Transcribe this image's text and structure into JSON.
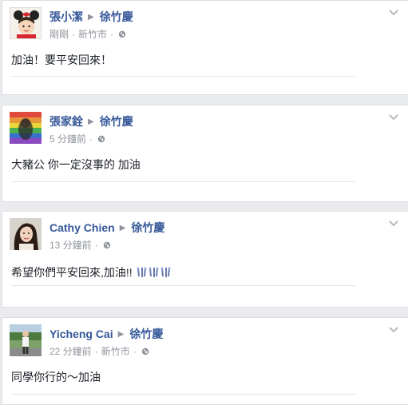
{
  "posts": [
    {
      "author": "張小潔",
      "target": "徐竹慶",
      "time": "剛剛",
      "location": "新竹市",
      "text": "加油！要平安回來！",
      "avatar_icon": "minnie-ears-avatar"
    },
    {
      "author": "張家銓",
      "target": "徐竹慶",
      "time": "5 分鐘前",
      "location": "",
      "text": "大豬公 你一定沒事的 加油",
      "avatar_icon": "rainbow-avatar"
    },
    {
      "author": "Cathy Chien",
      "target": "徐竹慶",
      "time": "13 分鐘前",
      "location": "",
      "text": "希望你們平安回來,加油!!",
      "avatar_icon": "woman-avatar"
    },
    {
      "author": "Yicheng Cai",
      "target": "徐竹慶",
      "time": "22 分鐘前",
      "location": "新竹市",
      "text": "同學你行的～加油",
      "avatar_icon": "outdoor-avatar"
    }
  ],
  "colors": {
    "link": "#365899",
    "meta": "#90949c",
    "text": "#1d2129",
    "background": "#e9ebee"
  }
}
